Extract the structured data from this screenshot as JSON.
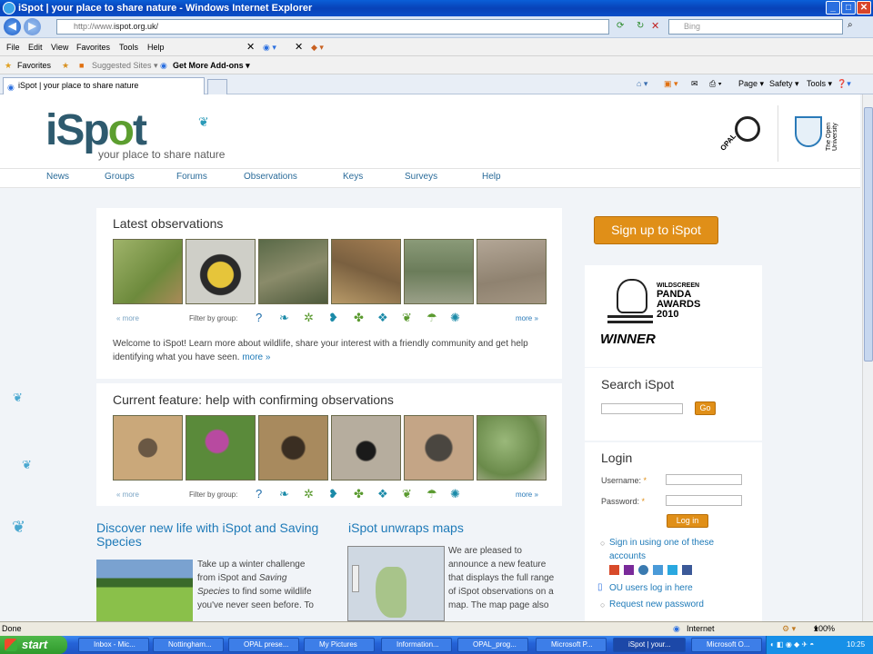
{
  "window": {
    "title": "iSpot | your place to share nature - Windows Internet Explorer"
  },
  "address": {
    "prefix": "http://www.",
    "domain": "ispot.org.uk/",
    "search_placeholder": "Bing"
  },
  "menu": [
    "File",
    "Edit",
    "View",
    "Favorites",
    "Tools",
    "Help"
  ],
  "favbar": {
    "favorites": "Favorites",
    "suggested": "Suggested Sites ▾",
    "addons": "Get More Add-ons ▾"
  },
  "tab": {
    "title": "iSpot | your place to share nature"
  },
  "commandbar": {
    "page": "Page ▾",
    "safety": "Safety ▾",
    "tools": "Tools ▾"
  },
  "site": {
    "logo_left": "iSp",
    "logo_leaf": "o",
    "logo_right": "t",
    "tagline": "your place to share nature",
    "opal": "OPAL",
    "ou": "The Open University",
    "nav": [
      "News",
      "Groups",
      "Forums",
      "Observations",
      "Keys",
      "Surveys",
      "Help"
    ]
  },
  "latest": {
    "title": "Latest observations",
    "less": "« more",
    "filter_label": "Filter by group:",
    "more": "more »",
    "intro": "Welcome to iSpot! Learn more about wildlife, share your interest with a friendly community and get help identifying what you have seen.",
    "intro_more": "more »"
  },
  "feature": {
    "title": "Current feature: help with confirming observations",
    "less": "« more",
    "filter_label": "Filter by group:",
    "more": "more »"
  },
  "articles": {
    "a1_title": "Discover new life with iSpot and Saving Species",
    "a1_text": "Take up a winter challenge from iSpot and",
    "a1_italic": "Saving Species",
    "a1_text2": "to find some wildlife you've never seen before. To",
    "a2_title": "iSpot unwraps maps",
    "a2_text": "We are pleased to announce a new feature that displays the full range of iSpot observations on a map. The map page also"
  },
  "sidebar": {
    "signup": "Sign up to iSpot",
    "award_top": "WILDSCREEN",
    "award_mid": "PANDA AWARDS 2010",
    "award_winner": "WINNER",
    "search_title": "Search iSpot",
    "go": "Go",
    "login_title": "Login",
    "username": "Username:",
    "password": "Password:",
    "login_btn": "Log in",
    "signin_other": "Sign in using one of these accounts",
    "ou_login": "OU users log in here",
    "request_pw": "Request new password"
  },
  "status": {
    "left": "Done",
    "zone": "Internet",
    "zoom": "100%"
  },
  "taskbar": {
    "start": "start",
    "tasks": [
      "Inbox - Mic...",
      "Nottingham...",
      "OPAL prese...",
      "My Pictures",
      "Information...",
      "OPAL_prog...",
      "Microsoft P...",
      "iSpot | your...",
      "Microsoft O..."
    ],
    "clock": "10:25"
  },
  "colors": {
    "accent": "#e08f18",
    "link": "#1e7ab8",
    "brand": "#2e5a6e"
  }
}
